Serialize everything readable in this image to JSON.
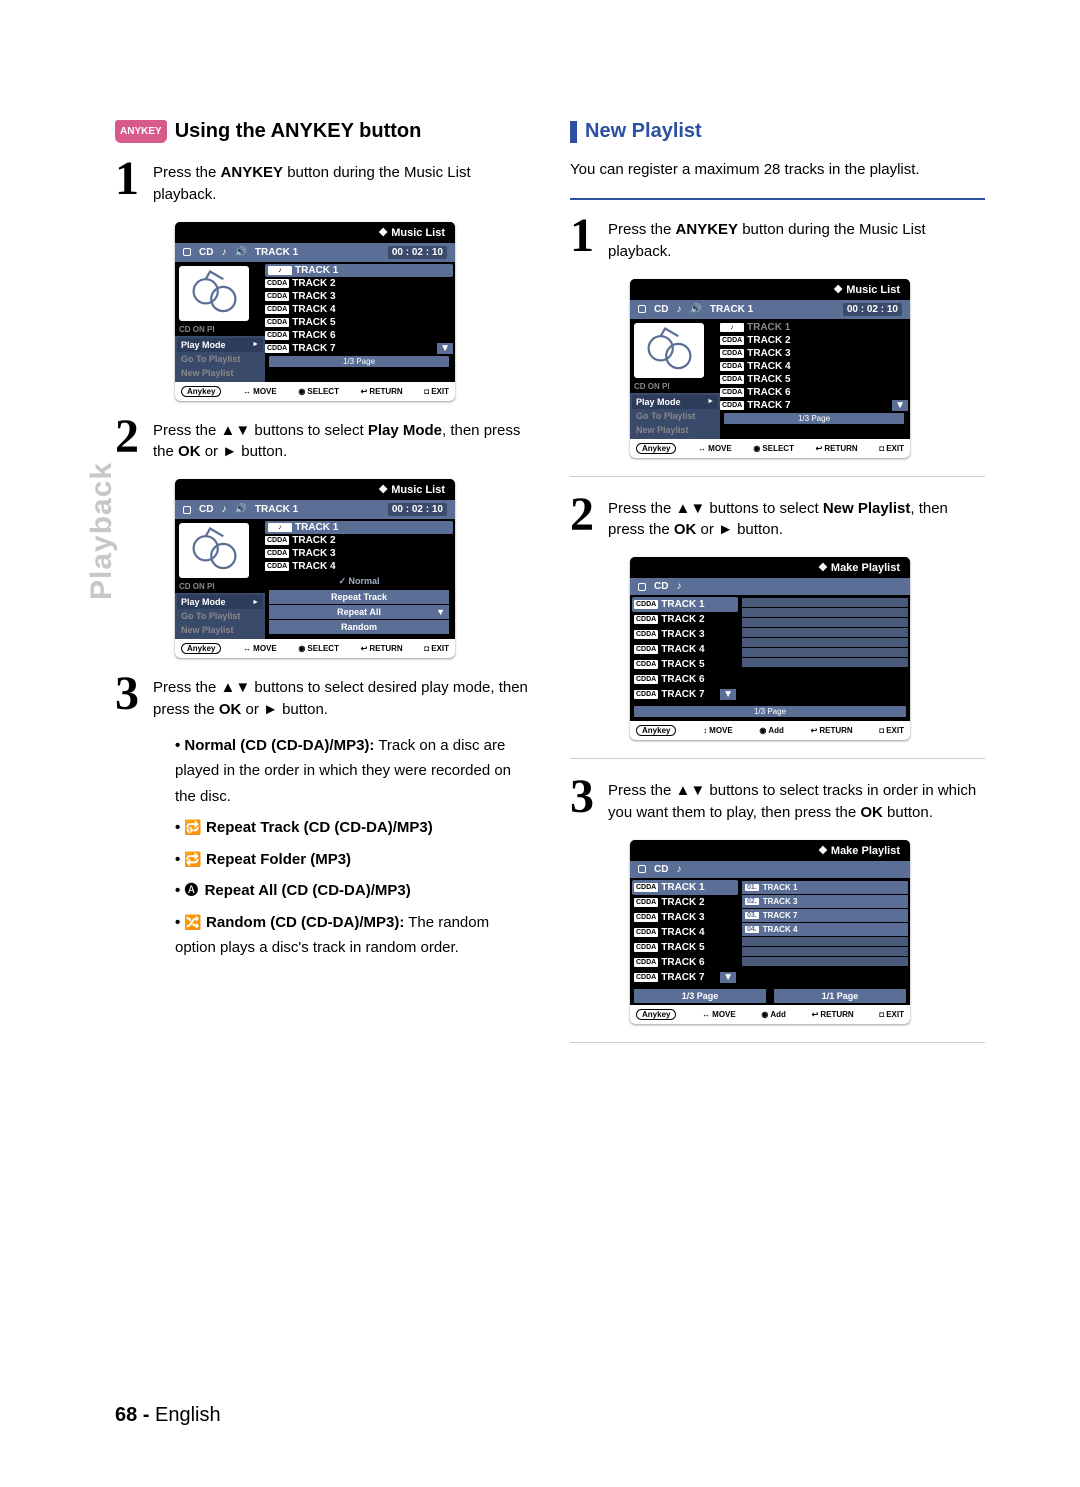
{
  "side_label": "Playback",
  "anykey_badge": "ANYKEY",
  "left": {
    "heading": "Using the ANYKEY button",
    "step1": {
      "num": "1",
      "text_pre": "Press the ",
      "anykey": "ANYKEY",
      "text_post": " button during the Music List playback."
    },
    "step2": {
      "num": "2",
      "t1": "Press the ",
      "btns": "▲▼",
      "t2": " buttons to select ",
      "target": "Play Mode",
      "t3": ", then press the ",
      "ok": "OK",
      "t4": " or ",
      "play": "►",
      "t5": " button."
    },
    "step3": {
      "num": "3",
      "t1": "Press the ",
      "btns": "▲▼",
      "t2": " buttons to select desired play mode, then press the ",
      "ok": "OK",
      "t3": " or ",
      "play": "►",
      "t4": " button."
    },
    "bullets": {
      "b1_label": "Normal (CD (CD-DA)/MP3):",
      "b1_text": " Track on a disc are played in the order in which they were recorded on the disc.",
      "b2": "Repeat Track (CD (CD-DA)/MP3)",
      "b3": "Repeat Folder (MP3)",
      "b4": "Repeat All (CD (CD-DA)/MP3)",
      "b5_label": "Random (CD (CD-DA)/MP3):",
      "b5_text": " The random option plays a disc's track in random order."
    }
  },
  "right": {
    "heading": "New Playlist",
    "intro": "You can register a maximum 28 tracks in the playlist.",
    "step1": {
      "num": "1",
      "text_pre": "Press the ",
      "anykey": "ANYKEY",
      "text_post": " button during the Music List playback."
    },
    "step2": {
      "num": "2",
      "t1": "Press the ",
      "btns": "▲▼",
      "t2": " buttons to select ",
      "target": "New Playlist",
      "t3": ", then press the ",
      "ok": "OK",
      "t4": " or ",
      "play": "►",
      "t5": " button."
    },
    "step3": {
      "num": "3",
      "t1": "Press the ",
      "btns": "▲▼",
      "t2": " buttons to select tracks in order in which you want them to play, then press the ",
      "ok": "OK",
      "t3": " button."
    }
  },
  "osd": {
    "music_title": "Music List",
    "make_title": "Make Playlist",
    "cd": "CD",
    "spk": "🔊",
    "nowplaying": "TRACK 1",
    "time": "00 : 02 : 10",
    "menu": {
      "play_mode": "Play Mode",
      "goto": "Go To Playlist",
      "newpl": "New Playlist"
    },
    "tracks": [
      "TRACK 1",
      "TRACK 2",
      "TRACK 3",
      "TRACK 4",
      "TRACK 5",
      "TRACK 6",
      "TRACK 7"
    ],
    "tag": "CDDA",
    "tag_first": "♪",
    "page": "1/3 Page",
    "page_r": "1/1 Page",
    "submenu": [
      "Normal",
      "Repeat Track",
      "Repeat All",
      "Random"
    ],
    "ftr": {
      "anykey": "Anykey",
      "move": "MOVE",
      "select": "SELECT",
      "add": "Add",
      "return": "RETURN",
      "exit": "EXIT"
    },
    "ftr_icons": {
      "move": "↔",
      "move_v": "↕",
      "select": "◉",
      "return": "↩",
      "exit": "◘"
    },
    "selected_order": [
      {
        "n": "01.",
        "t": "TRACK 1"
      },
      {
        "n": "02.",
        "t": "TRACK 3"
      },
      {
        "n": "03.",
        "t": "TRACK 7"
      },
      {
        "n": "04.",
        "t": "TRACK 4"
      }
    ],
    "cd_play": "CD  ON  Pl"
  },
  "footer": {
    "page": "68 -",
    "lang": "English"
  }
}
